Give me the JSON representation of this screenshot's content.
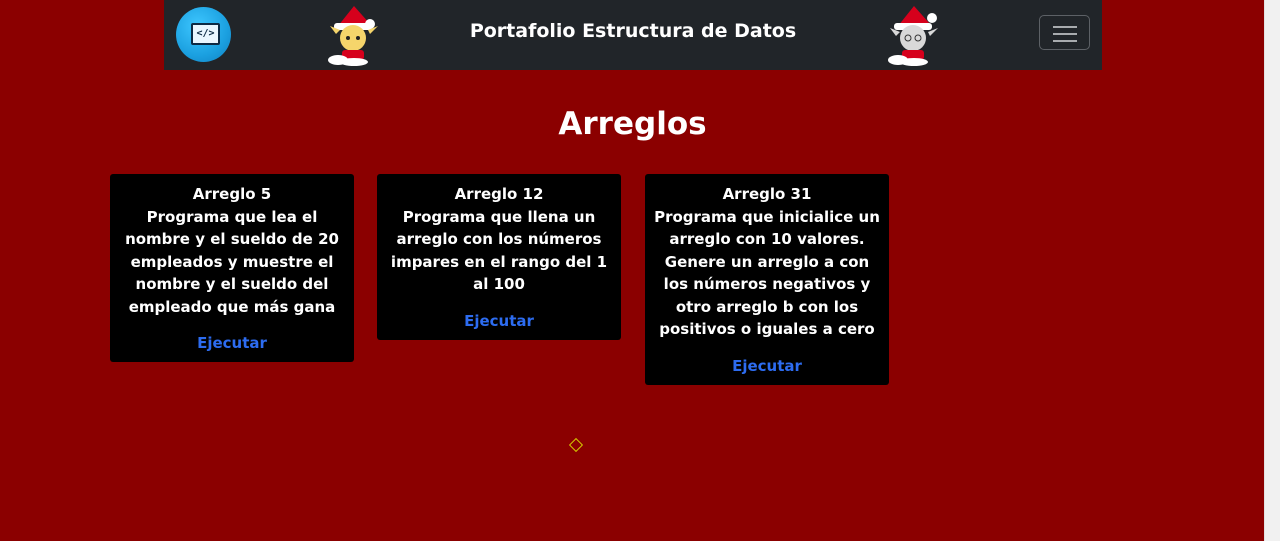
{
  "navbar": {
    "title": "Portafolio Estructura de Datos",
    "logo_icon": "code-laptop-icon",
    "menu_icon": "hamburger-menu-icon"
  },
  "main": {
    "heading": "Arreglos",
    "cards": [
      {
        "title": "Arreglo 5",
        "description": "Programa que lea el nombre y el sueldo de 20 empleados y muestre el nombre y el sueldo del empleado que más gana",
        "action": "Ejecutar"
      },
      {
        "title": "Arreglo 12",
        "description": "Programa que llena un arreglo con los números impares en el rango del 1 al 100",
        "action": "Ejecutar"
      },
      {
        "title": "Arreglo 31",
        "description": "Programa que inicialice un arreglo con 10 valores. Genere un arreglo a con los números negativos y otro arreglo b con los positivos o iguales a cero",
        "action": "Ejecutar"
      }
    ]
  },
  "colors": {
    "background": "#8b0000",
    "navbar": "#212529",
    "card": "#000000",
    "link": "#2d6cf0"
  }
}
